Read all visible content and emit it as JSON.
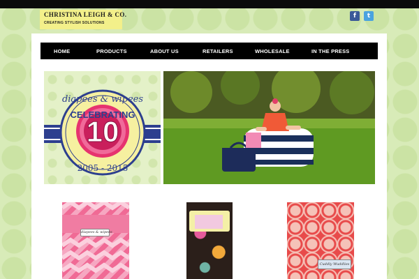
{
  "brand": {
    "name": "CHRISTINA LEIGH & CO.",
    "tagline": "CREATING STYLISH SOLUTIONS",
    "colors": {
      "logo_bg": "#f3f08a",
      "nav_bg": "#000000",
      "page_bg": "#d8ebb8"
    }
  },
  "social": [
    {
      "icon": "facebook-icon",
      "glyph": "f"
    },
    {
      "icon": "twitter-icon",
      "glyph": "t"
    }
  ],
  "nav": {
    "items": [
      "HOME",
      "PRODUCTS",
      "ABOUT US",
      "RETAILERS",
      "WHOLESALE",
      "IN THE PRESS"
    ]
  },
  "celebration": {
    "title": "diapees & wipees",
    "banner": "CELEBRATING",
    "number": "10",
    "years": "2005 - 2015"
  },
  "products": [
    {
      "name": "pink-chevron-case",
      "tag": "diapees & wipees"
    },
    {
      "name": "floral-pocket-case",
      "tag": ""
    },
    {
      "name": "red-medallion-case",
      "tag": "Cuddly Wuddlies"
    }
  ]
}
